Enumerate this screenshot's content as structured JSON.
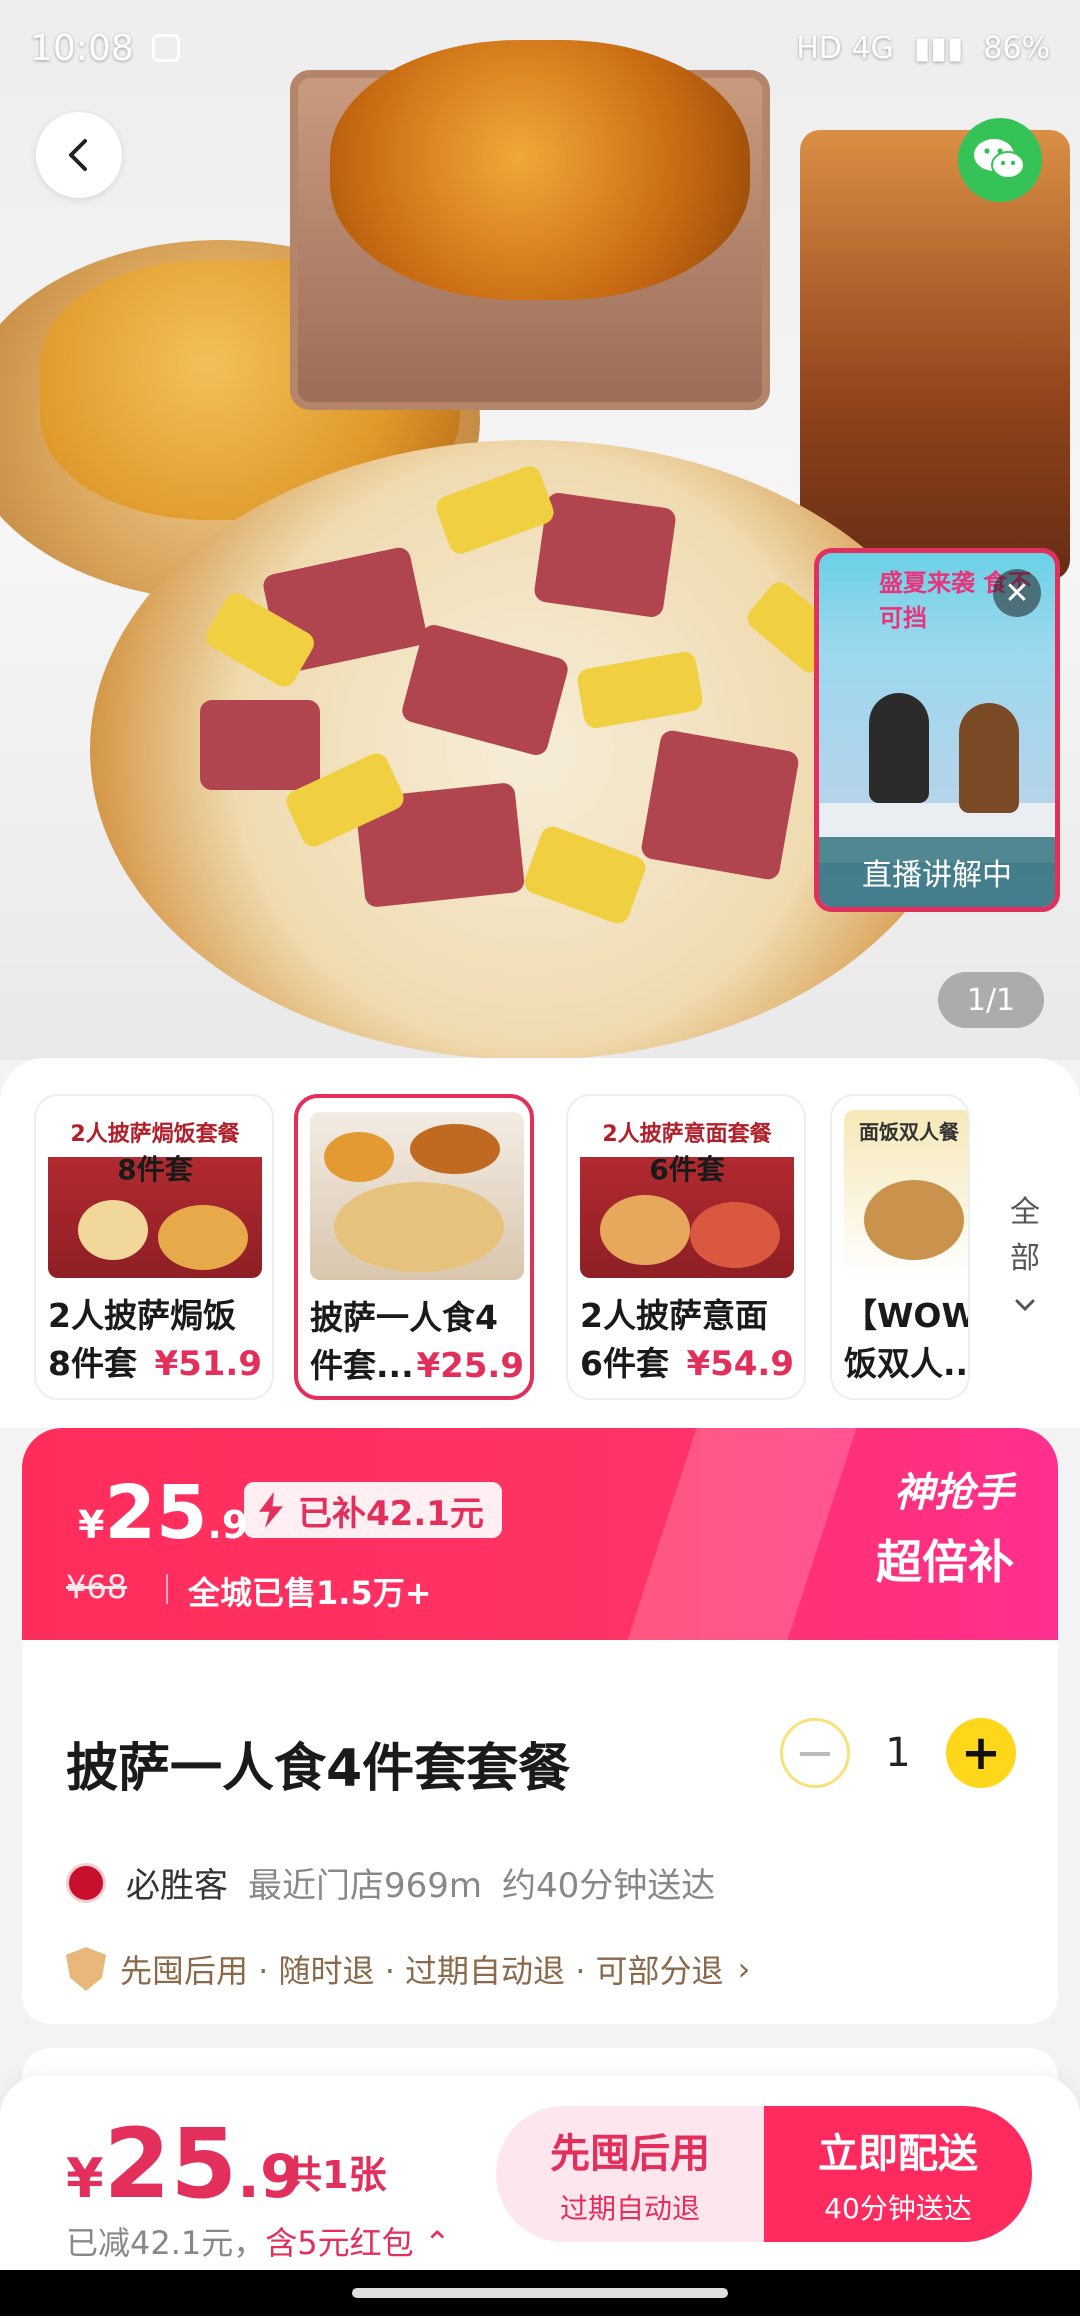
{
  "status_bar": {
    "time": "10:08",
    "network": "HD 4G",
    "battery": "86%"
  },
  "hero": {
    "pager": "1/1",
    "live_caption": "直播讲解中",
    "live_banner": "盛夏来袭 食不可挡"
  },
  "variants": [
    {
      "image_tag": "2人披萨焗饭套餐",
      "image_tag2": "8件套",
      "line1": "2人披萨焗饭",
      "line2": "8件套",
      "price": "¥51.9",
      "selected": false
    },
    {
      "image_tag": "",
      "image_tag2": "",
      "line1": "披萨一人食4",
      "line2": "件套...",
      "price": "¥25.9",
      "selected": true
    },
    {
      "image_tag": "2人披萨意面套餐",
      "image_tag2": "6件套",
      "line1": "2人披萨意面",
      "line2": "6件套",
      "price": "¥54.9",
      "selected": false
    },
    {
      "image_tag": "面饭双人餐",
      "image_tag2": "",
      "line1": "【WOW】",
      "line2": "饭双人...",
      "price": "",
      "selected": false
    }
  ],
  "all_button": {
    "label1": "全",
    "label2": "部",
    "icon": "chevron-down-icon"
  },
  "promo": {
    "yen": "¥",
    "price_int": "25",
    "price_dec": ".9",
    "subsidy": "已补42.1元",
    "original_price": "¥68",
    "sold": "全城已售1.5万+",
    "brand_line1": "神抢手",
    "brand_line2": "超倍补"
  },
  "product": {
    "title": "披萨一人食4件套套餐",
    "quantity": "1",
    "shop_name": "必胜客",
    "nearest_store": "最近门店969m",
    "delivery_time": "约40分钟送达",
    "guarantee": "先囤后用 · 随时退 · 过期自动退 · 可部分退"
  },
  "bottom_bar": {
    "yen": "¥",
    "price_int": "25",
    "price_dec": ".9",
    "count": "共1张",
    "saved": "已减42.1元，",
    "coupon": "含5元红包",
    "btn_left_main": "先囤后用",
    "btn_left_sub": "过期自动退",
    "btn_right_main": "立即配送",
    "btn_right_sub": "40分钟送达"
  },
  "colors": {
    "accent": "#ff2a5e",
    "yellow": "#ffd71a",
    "wechat": "#35c256"
  }
}
